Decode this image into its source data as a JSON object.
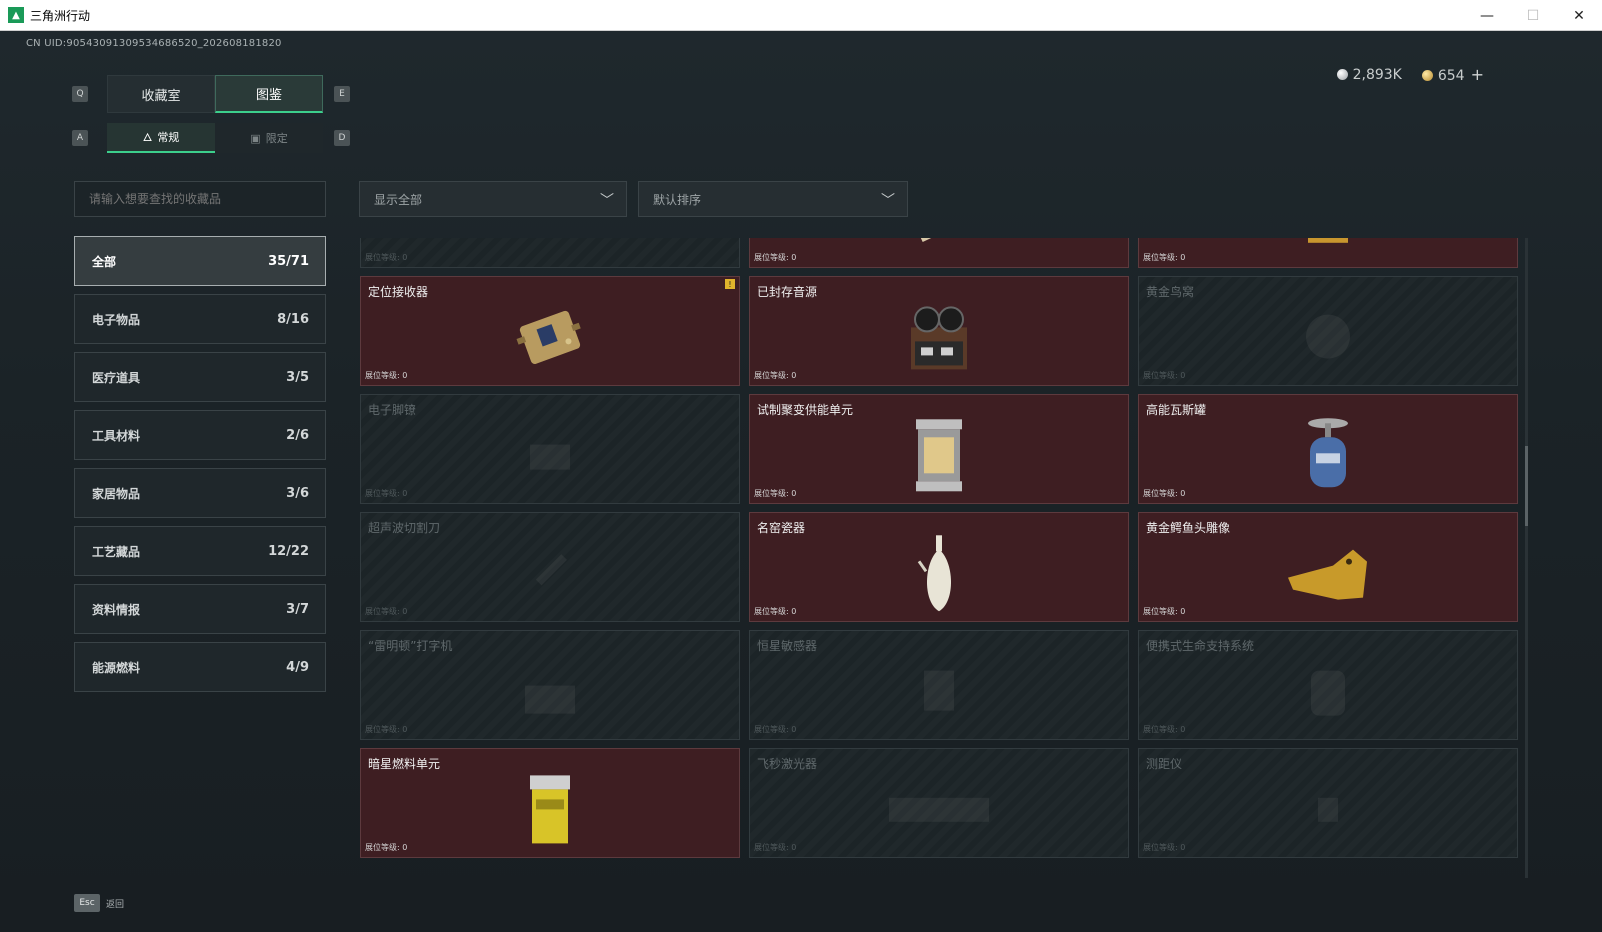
{
  "window": {
    "title": "三角洲行动",
    "minimize": "—",
    "maximize": "☐",
    "close": "✕"
  },
  "uid": "CN UID:90543091309534686520_202608181820",
  "currency": {
    "silver": "2,893K",
    "gold": "654",
    "add": "+"
  },
  "keys": {
    "left_tab": "Q",
    "right_tab": "E",
    "left_sub": "A",
    "right_sub": "D"
  },
  "tabs": [
    {
      "label": "收藏室",
      "active": false
    },
    {
      "label": "图鉴",
      "active": true
    }
  ],
  "subtabs": [
    {
      "label": "常规",
      "icon": "flame-icon",
      "active": true
    },
    {
      "label": "限定",
      "icon": "image-icon",
      "active": false
    }
  ],
  "search": {
    "placeholder": "请输入想要查找的收藏品"
  },
  "filters": {
    "display": "显示全部",
    "sort": "默认排序"
  },
  "categories": [
    {
      "label": "全部",
      "count": "35/71",
      "active": true
    },
    {
      "label": "电子物品",
      "count": "8/16"
    },
    {
      "label": "医疗道具",
      "count": "3/5"
    },
    {
      "label": "工具材料",
      "count": "2/6"
    },
    {
      "label": "家居物品",
      "count": "3/6"
    },
    {
      "label": "工艺藏品",
      "count": "12/22"
    },
    {
      "label": "资料情报",
      "count": "3/7"
    },
    {
      "label": "能源燃料",
      "count": "4/9"
    }
  ],
  "level_label": "展位等级: 0",
  "items": [
    {
      "name": "",
      "owned": false,
      "icon": "tool-icon"
    },
    {
      "name": "",
      "owned": true,
      "icon": "painting-scroll-icon"
    },
    {
      "name": "",
      "owned": true,
      "icon": "framed-painting-icon"
    },
    {
      "name": "定位接收器",
      "owned": true,
      "icon": "receiver-icon",
      "badge": "!"
    },
    {
      "name": "已封存音源",
      "owned": true,
      "icon": "reel-recorder-icon"
    },
    {
      "name": "黄金鸟窝",
      "owned": false,
      "icon": "bird-nest-icon"
    },
    {
      "name": "电子脚镣",
      "owned": false,
      "icon": "anklet-icon"
    },
    {
      "name": "试制聚变供能单元",
      "owned": true,
      "icon": "fusion-unit-icon"
    },
    {
      "name": "高能瓦斯罐",
      "owned": true,
      "icon": "gas-canister-icon"
    },
    {
      "name": "超声波切割刀",
      "owned": false,
      "icon": "cutter-icon"
    },
    {
      "name": "名窑瓷器",
      "owned": true,
      "icon": "porcelain-vase-icon"
    },
    {
      "name": "黄金鳄鱼头雕像",
      "owned": true,
      "icon": "crocodile-head-icon"
    },
    {
      "name": "“雷明顿”打字机",
      "owned": false,
      "icon": "typewriter-icon"
    },
    {
      "name": "恒星敏感器",
      "owned": false,
      "icon": "star-sensor-icon"
    },
    {
      "name": "便携式生命支持系统",
      "owned": false,
      "icon": "life-support-icon"
    },
    {
      "name": "暗星燃料单元",
      "owned": true,
      "icon": "fuel-cell-icon"
    },
    {
      "name": "飞秒激光器",
      "owned": false,
      "icon": "laser-icon"
    },
    {
      "name": "测距仪",
      "owned": false,
      "icon": "rangefinder-icon"
    }
  ],
  "footer": {
    "key": "Esc",
    "label": "返回"
  }
}
